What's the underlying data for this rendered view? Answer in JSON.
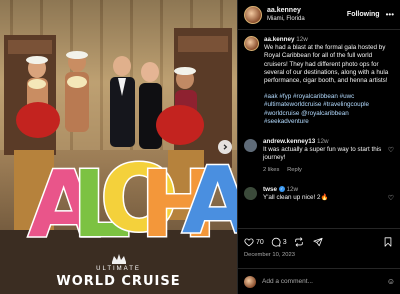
{
  "post": {
    "username": "aa.kenney",
    "location": "Miami, Florida",
    "follow_label": "Following",
    "more_label": "•••"
  },
  "photo": {
    "sign_letters": [
      "A",
      "L",
      "O",
      "H",
      "A"
    ],
    "sign_colors": [
      "#e9558a",
      "#7cc242",
      "#f4d13b",
      "#f3973a",
      "#4a8fe0"
    ],
    "brand_top": "ULTIMATE",
    "brand_main": "WORLD CRUISE"
  },
  "caption": {
    "username": "aa.kenney",
    "time": "12w",
    "text": "We had a blast at the formal gala hosted by Royal Caribbean for all of the full world cruisers! They had different photo ops for several of our destinations, along with a hula performance, cigar booth, and henna artists!",
    "tags": "#aak #fyp #royalcaribbean #uwc #ultimateworldcruise #travelingcouple #worldcruise @royalcaribbean #seekadventure"
  },
  "comments": [
    {
      "username": "andrew.kenney13",
      "time": "12w",
      "text": "It was actually a super fun way to start this journey!",
      "likes": "2 likes",
      "reply": "Reply",
      "avatar_color": "#5f6b78"
    },
    {
      "username": "twse",
      "verified_mark": "✓",
      "time": "12w",
      "text": "Y'all clean up nice! 2🔥",
      "avatar_color": "#3b4a3a"
    }
  ],
  "actions": {
    "like_count": "70",
    "comment_count": "3",
    "date": "December 10, 2023"
  },
  "add_comment": {
    "placeholder": "Add a comment..."
  }
}
